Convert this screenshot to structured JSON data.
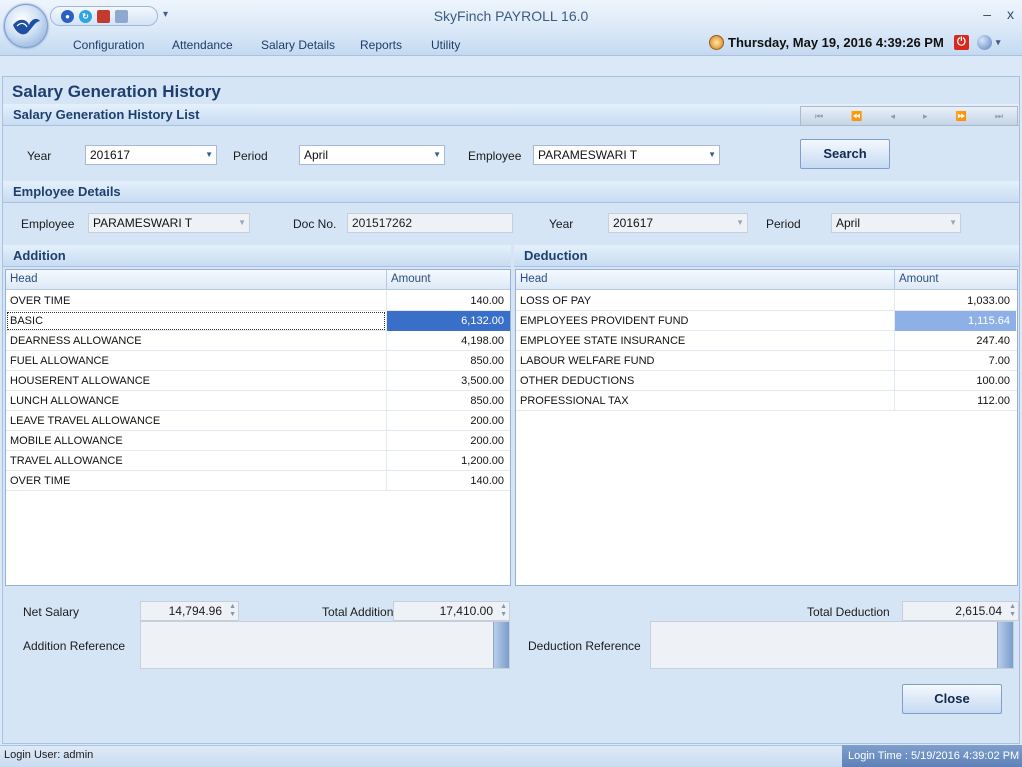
{
  "app": {
    "title": "SkyFinch   PAYROLL 16.0",
    "minimize": "–",
    "close": "x",
    "qat_dropdown": "▾"
  },
  "menu": [
    "Configuration",
    "Attendance",
    "Salary Details",
    "Reports",
    "Utility"
  ],
  "header": {
    "datetime": "Thursday, May 19, 2016 4:39:26 PM"
  },
  "page": {
    "title": "Salary Generation History",
    "list_section": "Salary Generation History List",
    "details_section": "Employee Details",
    "addition_section": "Addition",
    "deduction_section": "Deduction"
  },
  "navigator": [
    "⏮",
    "⏪",
    "◂",
    "▸",
    "⏩",
    "⏭"
  ],
  "filters": {
    "year_label": "Year",
    "year_value": "201617",
    "period_label": "Period",
    "period_value": "April",
    "employee_label": "Employee",
    "employee_value": "PARAMESWARI T",
    "search_label": "Search"
  },
  "details": {
    "employee_label": "Employee",
    "employee_value": "PARAMESWARI T",
    "docno_label": "Doc No.",
    "docno_value": "201517262",
    "year_label": "Year",
    "year_value": "201617",
    "period_label": "Period",
    "period_value": "April"
  },
  "addition": {
    "head_col": "Head",
    "amount_col": "Amount",
    "rows": [
      {
        "head": "OVER TIME",
        "amount": "140.00"
      },
      {
        "head": "BASIC",
        "amount": "6,132.00"
      },
      {
        "head": "DEARNESS ALLOWANCE",
        "amount": "4,198.00"
      },
      {
        "head": "FUEL ALLOWANCE",
        "amount": "850.00"
      },
      {
        "head": "HOUSERENT ALLOWANCE",
        "amount": "3,500.00"
      },
      {
        "head": "LUNCH ALLOWANCE",
        "amount": "850.00"
      },
      {
        "head": "LEAVE TRAVEL ALLOWANCE",
        "amount": "200.00"
      },
      {
        "head": "MOBILE ALLOWANCE",
        "amount": "200.00"
      },
      {
        "head": "TRAVEL ALLOWANCE",
        "amount": "1,200.00"
      },
      {
        "head": "OVER TIME",
        "amount": "140.00"
      }
    ]
  },
  "deduction": {
    "head_col": "Head",
    "amount_col": "Amount",
    "rows": [
      {
        "head": "LOSS OF PAY",
        "amount": "1,033.00"
      },
      {
        "head": "EMPLOYEES PROVIDENT FUND",
        "amount": "1,115.64"
      },
      {
        "head": "EMPLOYEE STATE INSURANCE",
        "amount": "247.40"
      },
      {
        "head": "LABOUR WELFARE FUND",
        "amount": "7.00"
      },
      {
        "head": "OTHER DEDUCTIONS",
        "amount": "100.00"
      },
      {
        "head": "PROFESSIONAL TAX",
        "amount": "112.00"
      }
    ]
  },
  "summary": {
    "net_salary_label": "Net Salary",
    "net_salary": "14,794.96",
    "total_addition_label": "Total Addition",
    "total_addition": "17,410.00",
    "total_deduction_label": "Total Deduction",
    "total_deduction": "2,615.04",
    "addition_ref_label": "Addition Reference",
    "deduction_ref_label": "Deduction Reference",
    "close_label": "Close"
  },
  "status": {
    "login_user": "Login User: admin",
    "login_time": "Login Time : 5/19/2016 4:39:02 PM"
  },
  "colors": {
    "accent": "#1e3f6e",
    "selection": "#3a6fc9",
    "selection_light": "#8fb0e6"
  }
}
